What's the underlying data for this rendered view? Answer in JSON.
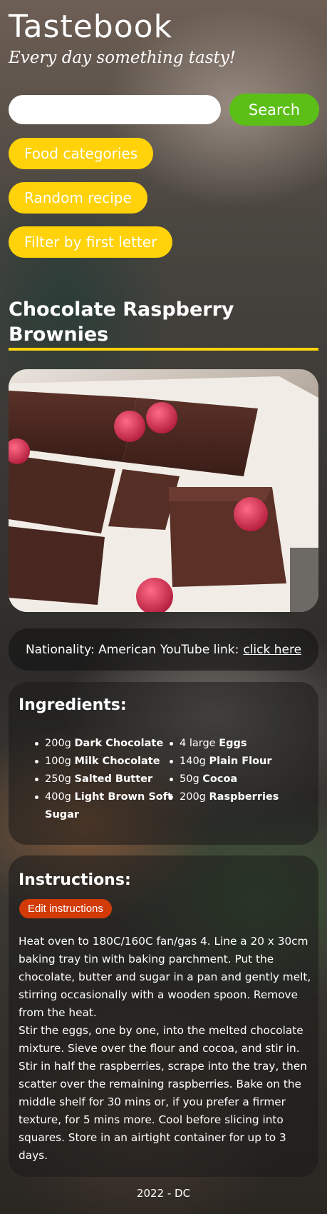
{
  "header": {
    "title": "Tastebook",
    "tagline": "Every day something tasty!"
  },
  "search": {
    "placeholder": "",
    "button_label": "Search"
  },
  "nav": {
    "categories": "Food categories",
    "random": "Random recipe",
    "filter": "Filter by first letter"
  },
  "colors": {
    "accent_yellow": "#ffd20a",
    "search_green": "#5cbf18",
    "edit_red": "#d23a08"
  },
  "recipe": {
    "title": "Chocolate Raspberry Brownies",
    "image_alt": "chocolate raspberry brownies photo",
    "nationality_label": "Nationality: American",
    "youtube_label": "YouTube link:",
    "youtube_link_text": "click here"
  },
  "ingredients": {
    "heading": "Ingredients:",
    "left": [
      {
        "qty": "200g",
        "name": "Dark Chocolate"
      },
      {
        "qty": "100g",
        "name": "Milk Chocolate"
      },
      {
        "qty": "250g",
        "name": "Salted Butter"
      },
      {
        "qty": "400g",
        "name": "Light Brown Soft Sugar"
      }
    ],
    "right": [
      {
        "qty": "4 large",
        "name": "Eggs"
      },
      {
        "qty": "140g",
        "name": "Plain Flour"
      },
      {
        "qty": "50g",
        "name": "Cocoa"
      },
      {
        "qty": "200g",
        "name": "Raspberries"
      }
    ]
  },
  "instructions": {
    "heading": "Instructions:",
    "edit_label": "Edit instructions",
    "paragraphs": [
      "Heat oven to 180C/160C fan/gas 4. Line a 20 x 30cm baking tray tin with baking parchment. Put the chocolate, butter and sugar in a pan and gently melt, stirring occasionally with a wooden spoon. Remove from the heat.",
      "Stir the eggs, one by one, into the melted chocolate mixture. Sieve over the flour and cocoa, and stir in. Stir in half the raspberries, scrape into the tray, then scatter over the remaining raspberries. Bake on the middle shelf for 30 mins or, if you prefer a firmer texture, for 5 mins more. Cool before slicing into squares. Store in an airtight container for up to 3 days."
    ]
  },
  "footer": {
    "text": "2022 - DC"
  }
}
